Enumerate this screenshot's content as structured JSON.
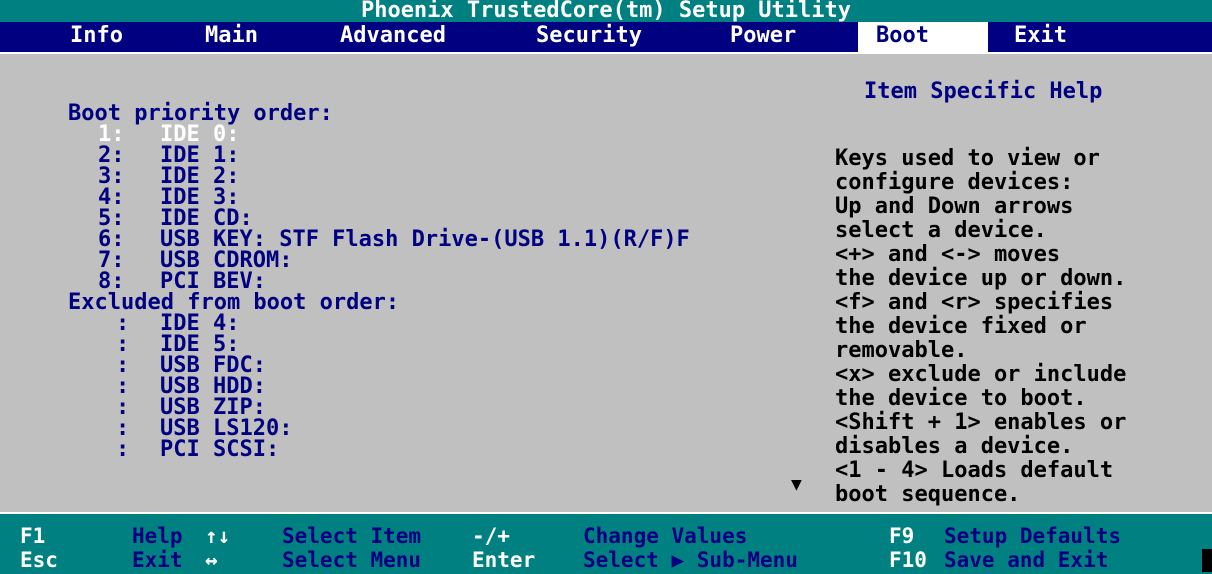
{
  "title": "Phoenix TrustedCore(tm) Setup Utility",
  "menu": {
    "info": "Info",
    "main": "Main",
    "advanced": "Advanced",
    "security": "Security",
    "power": "Power",
    "boot": "Boot",
    "exit": "Exit"
  },
  "boot": {
    "priority_heading": "Boot priority order:",
    "priority_items": [
      {
        "num": "1:",
        "label": "IDE 0:"
      },
      {
        "num": "2:",
        "label": "IDE 1:"
      },
      {
        "num": "3:",
        "label": "IDE 2:"
      },
      {
        "num": "4:",
        "label": "IDE 3:"
      },
      {
        "num": "5:",
        "label": "IDE CD:"
      },
      {
        "num": "6:",
        "label": "USB KEY: STF Flash Drive-(USB 1.1)(R/F)F"
      },
      {
        "num": "7:",
        "label": "USB CDROM:"
      },
      {
        "num": "8:",
        "label": "PCI BEV:"
      }
    ],
    "excluded_heading": "Excluded from boot order:",
    "excluded_items": [
      {
        "num": ":",
        "label": "IDE 4:"
      },
      {
        "num": ":",
        "label": "IDE 5:"
      },
      {
        "num": ":",
        "label": "USB FDC:"
      },
      {
        "num": ":",
        "label": "USB HDD:"
      },
      {
        "num": ":",
        "label": "USB ZIP:"
      },
      {
        "num": ":",
        "label": "USB LS120:"
      },
      {
        "num": ":",
        "label": "PCI SCSI:"
      }
    ],
    "scroll_arrow": "▼"
  },
  "help": {
    "title": "Item Specific Help",
    "lines": [
      "Keys used to view or",
      "configure devices:",
      "Up and Down arrows",
      "select a device.",
      "<+> and <-> moves",
      "the device up or down.",
      "<f> and <r> specifies",
      "the device fixed or",
      "removable.",
      "<x> exclude or include",
      "the device to boot.",
      "<Shift + 1> enables or",
      "disables a device.",
      "<1 - 4> Loads default",
      "boot sequence."
    ]
  },
  "footer": {
    "f1": "F1",
    "help": "Help",
    "updown": "↑↓",
    "select_item": "Select Item",
    "minusplus": "-/+",
    "change_values": "Change Values",
    "f9": "F9",
    "setup_defaults": "Setup Defaults",
    "esc": "Esc",
    "exit": "Exit",
    "leftright": "↔",
    "select_menu": "Select Menu",
    "enter": "Enter",
    "select_submenu": "Select ▶ Sub-Menu",
    "f10": "F10",
    "save_exit": "Save and Exit"
  }
}
